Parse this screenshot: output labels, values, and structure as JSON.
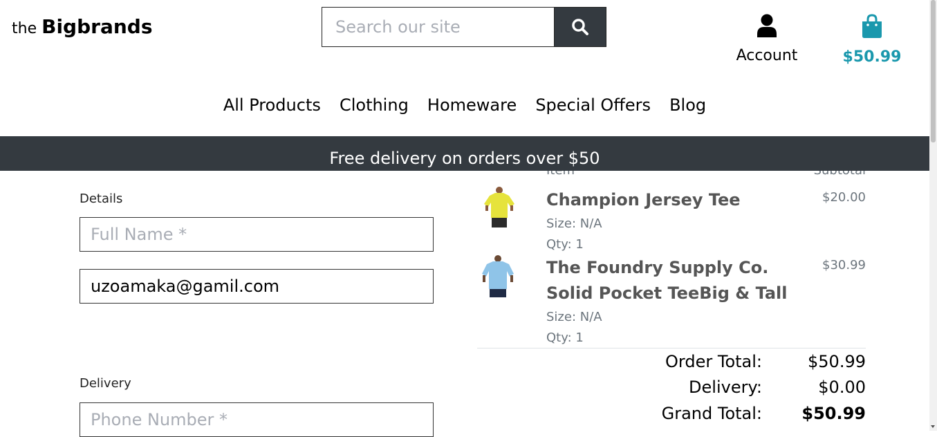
{
  "header": {
    "logo_prefix": "the",
    "logo_brand": "Bigbrands",
    "search_placeholder": "Search our site",
    "account_label": "Account",
    "cart_total": "$50.99"
  },
  "nav": {
    "items": [
      "All Products",
      "Clothing",
      "Homeware",
      "Special Offers",
      "Blog"
    ]
  },
  "banner": {
    "text": "Free delivery on orders over $50"
  },
  "form": {
    "details_label": "Details",
    "full_name_placeholder": "Full Name *",
    "email_value": "uzoamaka@gamil.com",
    "delivery_label": "Delivery",
    "phone_placeholder": "Phone Number *"
  },
  "summary": {
    "item_header": "Item",
    "subtotal_header": "Subtotal",
    "items": [
      {
        "name_line1": "Champion Jersey Tee",
        "name_line2": "",
        "size": "Size: N/A",
        "qty": "Qty: 1",
        "price": "$20.00",
        "shirt_color": "#e6e33c"
      },
      {
        "name_line1": "The Foundry Supply Co.",
        "name_line2": "Solid Pocket TeeBig & Tall",
        "size": "Size: N/A",
        "qty": "Qty: 1",
        "price": "$30.99",
        "shirt_color": "#8fc4e8"
      }
    ],
    "order_total_label": "Order Total:",
    "order_total_value": "$50.99",
    "delivery_label": "Delivery:",
    "delivery_value": "$0.00",
    "grand_total_label": "Grand Total:",
    "grand_total_value": "$50.99"
  },
  "colors": {
    "accent": "#1a98ad",
    "banner_bg": "#343a40"
  }
}
